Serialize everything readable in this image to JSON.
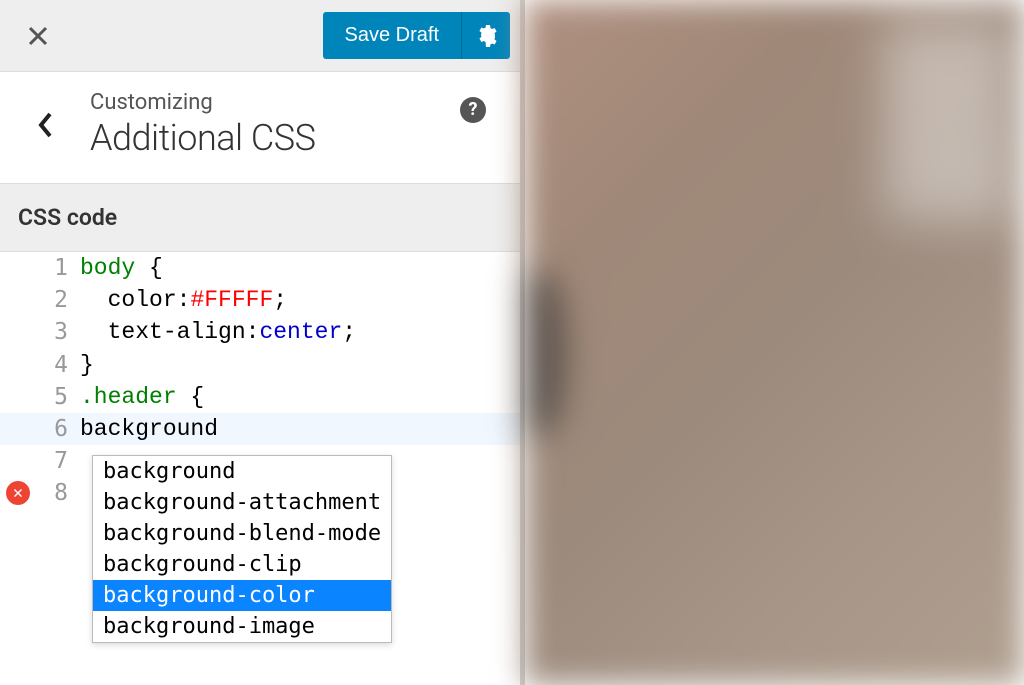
{
  "topbar": {
    "save_label": "Save Draft"
  },
  "header": {
    "breadcrumb": "Customizing",
    "title": "Additional CSS",
    "help_glyph": "?"
  },
  "section": {
    "label": "CSS code"
  },
  "code": {
    "lines": [
      {
        "n": "1",
        "tokens": [
          [
            "selector",
            "body"
          ],
          [
            "punc",
            " {"
          ]
        ]
      },
      {
        "n": "2",
        "tokens": [
          [
            "prop",
            "  color"
          ],
          [
            "colon",
            ":"
          ],
          [
            "colorval",
            "#FFFFF"
          ],
          [
            "punc",
            ";"
          ]
        ]
      },
      {
        "n": "3",
        "tokens": [
          [
            "prop",
            "  text-align"
          ],
          [
            "colon",
            ":"
          ],
          [
            "value",
            "center"
          ],
          [
            "punc",
            ";"
          ]
        ]
      },
      {
        "n": "4",
        "tokens": [
          [
            "punc",
            "}"
          ]
        ]
      },
      {
        "n": "5",
        "tokens": [
          [
            "selector",
            ".header"
          ],
          [
            "punc",
            " {"
          ]
        ]
      },
      {
        "n": "6",
        "highlight": true,
        "tokens": [
          [
            "prop",
            "background"
          ]
        ]
      },
      {
        "n": "7",
        "tokens": []
      },
      {
        "n": "8",
        "error": true,
        "tokens": []
      }
    ]
  },
  "autocomplete": {
    "items": [
      {
        "label": "background",
        "selected": false
      },
      {
        "label": "background-attachment",
        "selected": false
      },
      {
        "label": "background-blend-mode",
        "selected": false
      },
      {
        "label": "background-clip",
        "selected": false
      },
      {
        "label": "background-color",
        "selected": true
      },
      {
        "label": "background-image",
        "selected": false
      }
    ]
  }
}
